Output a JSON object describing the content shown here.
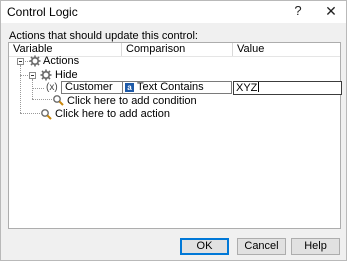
{
  "window": {
    "title": "Control Logic",
    "help_glyph": "?",
    "close_glyph": "✕"
  },
  "prompt": "Actions that should update this control:",
  "columns": {
    "variable": "Variable",
    "comparison": "Comparison",
    "value": "Value"
  },
  "tree": {
    "root_label": "Actions",
    "action_label": "Hide",
    "condition": {
      "variable_prefix": "(x)",
      "variable": "Customer",
      "comparison_badge": "a",
      "comparison": "Text Contains",
      "value": "XYZ"
    },
    "add_condition": "Click here to add condition",
    "add_action": "Click here to add action"
  },
  "buttons": {
    "ok": "OK",
    "cancel": "Cancel",
    "help": "Help"
  },
  "colors": {
    "accent": "#0078d7",
    "gear": "#6b6b6b",
    "badge": "#1e5aa8"
  }
}
